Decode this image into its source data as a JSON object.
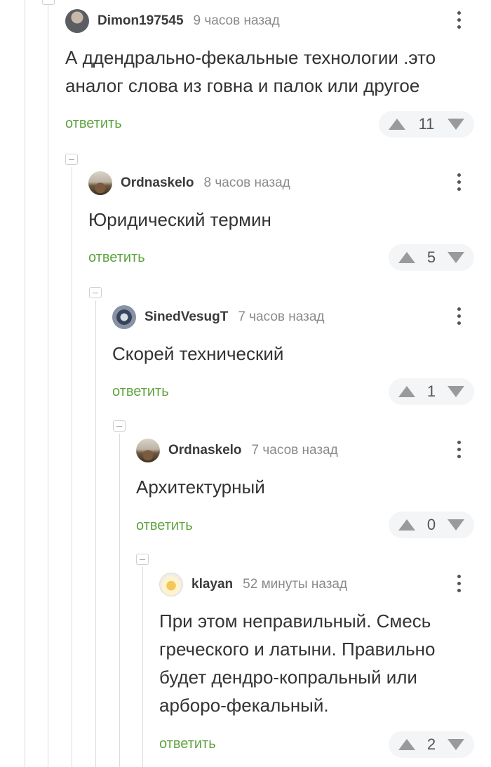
{
  "comments": [
    {
      "username": "Dimon197545",
      "time": "9 часов назад",
      "text_lines": [
        "А ддендрально-фекальные технологии .это",
        "аналог слова из говна и палок или другое"
      ],
      "reply_label": "ответить",
      "votes": "11",
      "avatar": "avatar-photo-man"
    },
    {
      "username": "Ordnaskelo",
      "time": "8 часов назад",
      "text_lines": [
        "Юридический термин"
      ],
      "reply_label": "ответить",
      "votes": "5",
      "avatar": "avatar-photo-road"
    },
    {
      "username": "SinedVesugT",
      "time": "7 часов назад",
      "text_lines": [
        "Скорей технический"
      ],
      "reply_label": "ответить",
      "votes": "1",
      "avatar": "avatar-knight"
    },
    {
      "username": "Ordnaskelo",
      "time": "7 часов назад",
      "text_lines": [
        "Архитектурный"
      ],
      "reply_label": "ответить",
      "votes": "0",
      "avatar": "avatar-photo-road"
    },
    {
      "username": "klayan",
      "time": "52 минуты назад",
      "text_lines": [
        "При этом неправильный. Смесь",
        "греческого и латыни. Правильно",
        "будет дендро-копральный или",
        "арборо-фекальный."
      ],
      "reply_label": "ответить",
      "votes": "2",
      "avatar": "avatar-cartoon"
    }
  ],
  "colors": {
    "reply_link": "#5ea33f",
    "thread_line": "#dcdcdc",
    "vote_background": "#f4f5f7",
    "vote_arrow": "#9a9a9a"
  },
  "icons": {
    "upvote": "triangle-up-icon",
    "downvote": "triangle-down-icon",
    "menu": "more-vertical-icon",
    "collapse": "collapse-minus-icon"
  }
}
